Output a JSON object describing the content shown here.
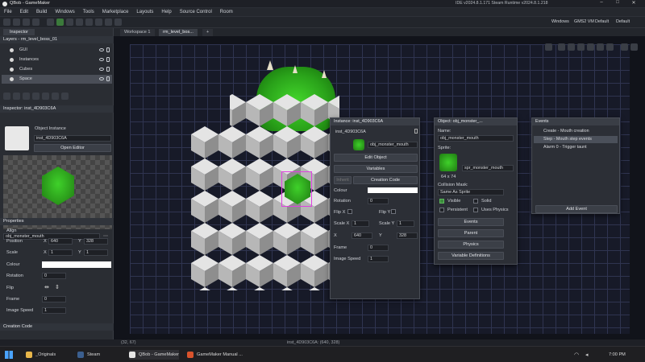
{
  "titlebar": {
    "title": "QBob - GameMaker",
    "ide_version": "IDE v2024.8.1.171 Steam  Runtime v2024.8.1.218"
  },
  "menu": [
    "File",
    "Edit",
    "Build",
    "Windows",
    "Tools",
    "Marketplace",
    "Layouts",
    "Help",
    "Source Control",
    "Room"
  ],
  "toolbar": {
    "target_windows": "Windows",
    "target_vm": "GMS2 VM",
    "target_default": "Default",
    "config_default": "Default"
  },
  "tabs": {
    "workspace": "Workspace 1",
    "room": "rm_level_bos...",
    "add": "+"
  },
  "inspector": {
    "tab": "Inspector",
    "layers_title": "Layers - rm_level_boss_01",
    "layers": [
      "GUI",
      "Instances",
      "Cubes",
      "Space"
    ],
    "instance_title": "Inspector: inst_4D903C6A",
    "object_instance_label": "Object Instance",
    "instance_name": "inst_4D903C6A",
    "open_editor": "Open Editor",
    "object_name": "obj_monster_mouth",
    "properties_title": "Properties",
    "align_label": "Align",
    "position_label": "Position",
    "pos_x_label": "X",
    "pos_x": "640",
    "pos_y_label": "Y",
    "pos_y": "328",
    "scale_label": "Scale",
    "scale_x_label": "X",
    "scale_x": "1",
    "scale_y_label": "Y",
    "scale_y": "1",
    "colour_label": "Colour",
    "rotation_label": "Rotation",
    "rotation": "0",
    "flip_label": "Flip",
    "frame_label": "Frame",
    "frame": "0",
    "image_speed_label": "Image Speed",
    "image_speed": "1",
    "creation_code": "Creation Code"
  },
  "instance_win": {
    "title": "Instance: inst_4D903C6A",
    "name": "inst_4D903C6A",
    "object": "obj_monster_mouth",
    "edit_object": "Edit Object",
    "variables": "Variables",
    "inherit": "Inherit",
    "creation_code": "Creation Code",
    "colour_label": "Colour",
    "rotation_label": "Rotation",
    "rotation": "0",
    "flip_x": "Flip X",
    "flip_y": "Flip Y",
    "scale_x_label": "Scale X",
    "scale_x": "1",
    "scale_y_label": "Scale Y",
    "scale_y": "1",
    "x_label": "X",
    "x": "640",
    "y_label": "Y",
    "y": "328",
    "frame_label": "Frame",
    "frame": "0",
    "image_speed_label": "Image Speed",
    "image_speed": "1"
  },
  "object_win": {
    "title": "Object: obj_monster_...",
    "name_label": "Name:",
    "name": "obj_monster_mouth",
    "sprite_label": "Sprite:",
    "sprite": "spr_monster_mouth",
    "sprite_size": "64 x 74",
    "collision_label": "Collision Mask:",
    "collision": "Same As Sprite",
    "visible": "Visible",
    "solid": "Solid",
    "persistent": "Persistent",
    "uses_physics": "Uses Physics",
    "events": "Events",
    "parent": "Parent",
    "physics": "Physics",
    "variable_definitions": "Variable Definitions"
  },
  "events_win": {
    "title": "Events",
    "items": [
      "Create - Mouth creation",
      "Step - Mouth step events",
      "Alarm 0 - Trigger taunt"
    ],
    "add_event": "Add Event"
  },
  "statusbar": {
    "coords": "(32, 67)",
    "selection": "inst_4D903C6A: (640, 328)"
  },
  "taskbar": {
    "items": [
      "_Originals",
      "Steam",
      "QBob - GameMaker",
      "GameMaker Manual ..."
    ],
    "time": "7:00 PM"
  },
  "colors": {
    "accent": "#3a8ee6",
    "grass": "#3fbf2a",
    "selection": "#e040e0"
  }
}
